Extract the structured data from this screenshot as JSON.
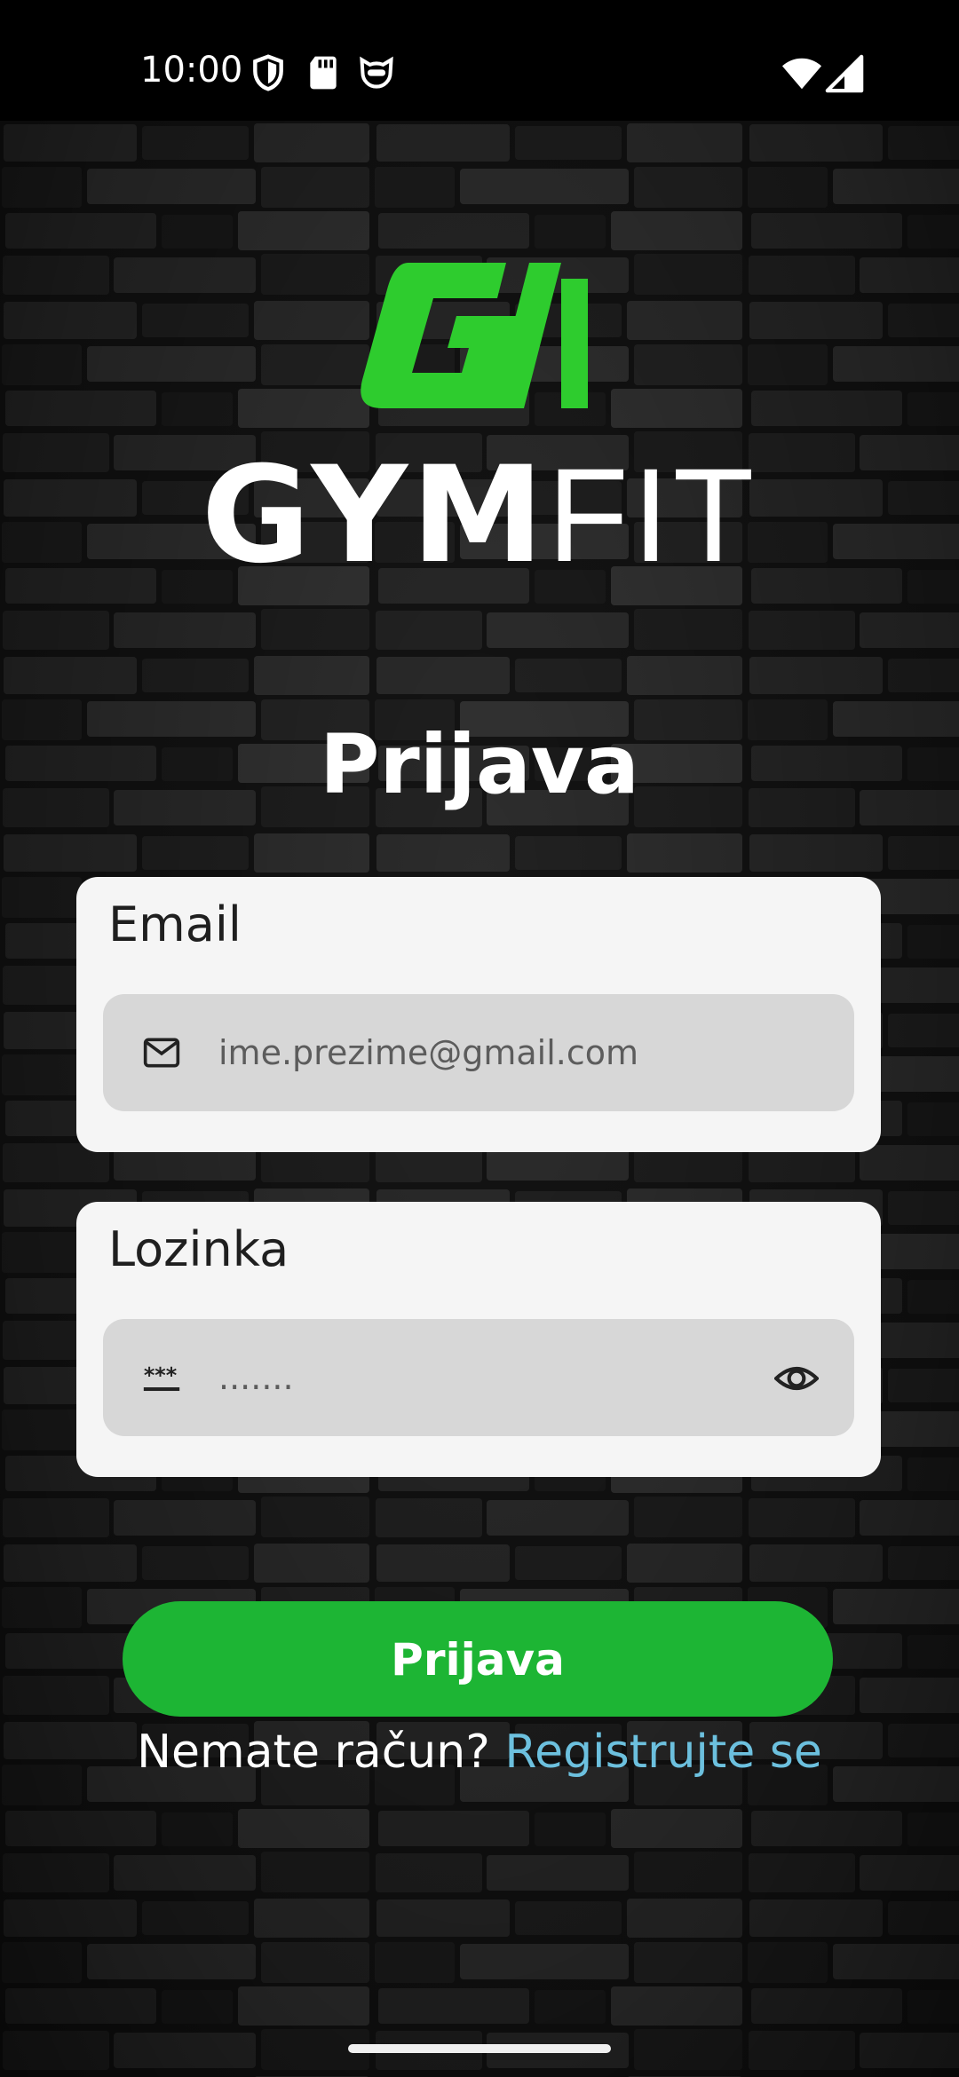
{
  "status_bar": {
    "time": "10:00",
    "icons": [
      "shield-icon",
      "sd-card-icon",
      "cat-face-icon",
      "wifi-icon",
      "signal-icon"
    ]
  },
  "brand": {
    "mark_text": "GII",
    "name_bold": "GYM",
    "name_light": "FIT",
    "accent_color": "#2ecc2e"
  },
  "page": {
    "title": "Prijava"
  },
  "email": {
    "label": "Email",
    "placeholder": "ime.prezime@gmail.com",
    "icon": "mail-icon"
  },
  "password": {
    "label": "Lozinka",
    "placeholder": ".......",
    "icon": "password-icon",
    "toggle_icon": "eye-icon"
  },
  "login_button": {
    "label": "Prijava",
    "color": "#1db534"
  },
  "register": {
    "prompt": "Nemate račun?",
    "link": "Registrujte se",
    "link_color": "#6cc0de"
  }
}
